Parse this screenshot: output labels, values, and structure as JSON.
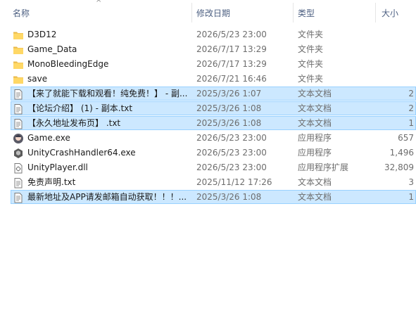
{
  "columns": {
    "name": "名称",
    "modified": "修改日期",
    "type": "类型",
    "size": "大小"
  },
  "files": [
    {
      "name": "D3D12",
      "date": "2026/5/23 23:00",
      "type": "文件夹",
      "size": "",
      "icon": "folder-icon",
      "selected": false
    },
    {
      "name": "Game_Data",
      "date": "2026/7/17 13:29",
      "type": "文件夹",
      "size": "",
      "icon": "folder-icon",
      "selected": false
    },
    {
      "name": "MonoBleedingEdge",
      "date": "2026/7/17 13:29",
      "type": "文件夹",
      "size": "",
      "icon": "folder-icon",
      "selected": false
    },
    {
      "name": "save",
      "date": "2026/7/21 16:46",
      "type": "文件夹",
      "size": "",
      "icon": "folder-icon",
      "selected": false
    },
    {
      "name": "【来了就能下载和观看！纯免费！】 - 副...",
      "date": "2025/3/26 1:07",
      "type": "文本文档",
      "size": "2",
      "icon": "text-file-icon",
      "selected": true
    },
    {
      "name": "【论坛介绍】 (1) - 副本.txt",
      "date": "2025/3/26 1:08",
      "type": "文本文档",
      "size": "2",
      "icon": "text-file-icon",
      "selected": true
    },
    {
      "name": "【永久地址发布页】 .txt",
      "date": "2025/3/26 1:08",
      "type": "文本文档",
      "size": "1",
      "icon": "text-file-icon",
      "selected": true
    },
    {
      "name": "Game.exe",
      "date": "2026/5/23 23:00",
      "type": "应用程序",
      "size": "657",
      "icon": "game-exe-icon",
      "selected": false
    },
    {
      "name": "UnityCrashHandler64.exe",
      "date": "2026/5/23 23:00",
      "type": "应用程序",
      "size": "1,496",
      "icon": "unity-icon",
      "selected": false
    },
    {
      "name": "UnityPlayer.dll",
      "date": "2026/5/23 23:00",
      "type": "应用程序扩展",
      "size": "32,809",
      "icon": "dll-file-icon",
      "selected": false
    },
    {
      "name": "免责声明.txt",
      "date": "2025/11/12 17:26",
      "type": "文本文档",
      "size": "3",
      "icon": "text-file-icon",
      "selected": false
    },
    {
      "name": "最新地址及APP请发邮箱自动获取！！！...",
      "date": "2025/3/26 1:08",
      "type": "文本文档",
      "size": "1",
      "icon": "text-file-icon",
      "selected": true
    }
  ]
}
